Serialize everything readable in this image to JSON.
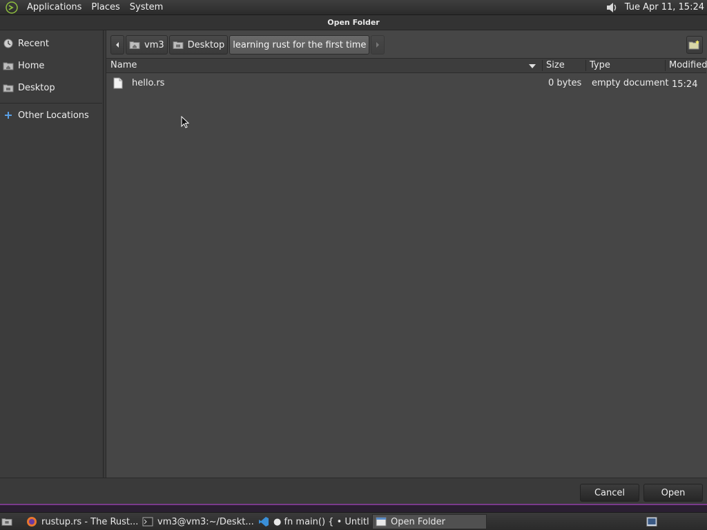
{
  "top_panel": {
    "menus": [
      "Applications",
      "Places",
      "System"
    ],
    "clock": "Tue Apr 11, 15:24"
  },
  "dialog": {
    "title": "Open Folder",
    "sidebar": {
      "items": [
        {
          "label": "Recent",
          "icon": "recent-icon"
        },
        {
          "label": "Home",
          "icon": "home-folder-icon"
        },
        {
          "label": "Desktop",
          "icon": "desktop-folder-icon"
        },
        {
          "label": "Other Locations",
          "icon": "plus-icon"
        }
      ]
    },
    "path_bar": {
      "segments": [
        "vm3",
        "Desktop",
        "learning rust for the first time"
      ],
      "active_index": 2
    },
    "columns": [
      "Name",
      "Size",
      "Type",
      "Modified"
    ],
    "files": [
      {
        "name": "hello.rs",
        "size": "0 bytes",
        "type": "empty document",
        "modified": "15:24",
        "icon": "document-icon"
      }
    ],
    "buttons": {
      "cancel": "Cancel",
      "open": "Open"
    }
  },
  "taskbar": {
    "tasks": [
      {
        "label": "rustup.rs - The Rust...",
        "icon": "firefox-icon"
      },
      {
        "label": "vm3@vm3:~/Deskt...",
        "icon": "terminal-icon"
      },
      {
        "label": "● fn main() { • Untitl...",
        "icon": "vscode-icon"
      },
      {
        "label": "Open Folder",
        "icon": "window-icon"
      }
    ]
  }
}
